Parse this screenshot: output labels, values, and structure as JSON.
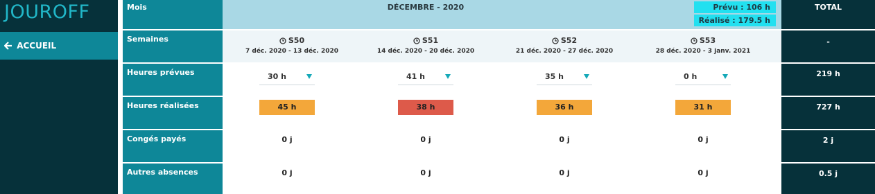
{
  "app": {
    "title": "JOUROFF"
  },
  "nav": {
    "home_label": "ACCUEIL"
  },
  "colors": {
    "over": "#f3a73a",
    "under": "#dd5a4a",
    "accent": "#0e8798",
    "dark": "#06313a",
    "band": "#a9d8e5",
    "pill": "#22e0f0"
  },
  "header": {
    "month_label": "Mois",
    "month": "DÉCEMBRE - 2020",
    "prevu": "Prévu : 106 h",
    "realise": "Réalisé : 179.5 h",
    "total_label": "TOTAL"
  },
  "rows": {
    "semaines": {
      "label": "Semaines",
      "total": "-"
    },
    "prevues": {
      "label": "Heures prévues",
      "total": "219 h"
    },
    "realisees": {
      "label": "Heures réalisées",
      "total": "727 h"
    },
    "conges": {
      "label": "Congés payés",
      "total": "2 j"
    },
    "absences": {
      "label": "Autres absences",
      "total": "0.5 j"
    }
  },
  "weeks": [
    {
      "name": "S50",
      "range": "7 déc. 2020 - 13 déc. 2020",
      "planned": "30 h",
      "actual": "45 h",
      "actual_status": "over",
      "conges": "0 j",
      "absences": "0 j"
    },
    {
      "name": "S51",
      "range": "14 déc. 2020 - 20 déc. 2020",
      "planned": "41 h",
      "actual": "38 h",
      "actual_status": "under",
      "conges": "0 j",
      "absences": "0 j"
    },
    {
      "name": "S52",
      "range": "21 déc. 2020 - 27 déc. 2020",
      "planned": "35 h",
      "actual": "36 h",
      "actual_status": "over",
      "conges": "0 j",
      "absences": "0 j"
    },
    {
      "name": "S53",
      "range": "28 déc. 2020 - 3 janv. 2021",
      "planned": "0 h",
      "actual": "31 h",
      "actual_status": "over",
      "conges": "0 j",
      "absences": "0 j"
    }
  ]
}
